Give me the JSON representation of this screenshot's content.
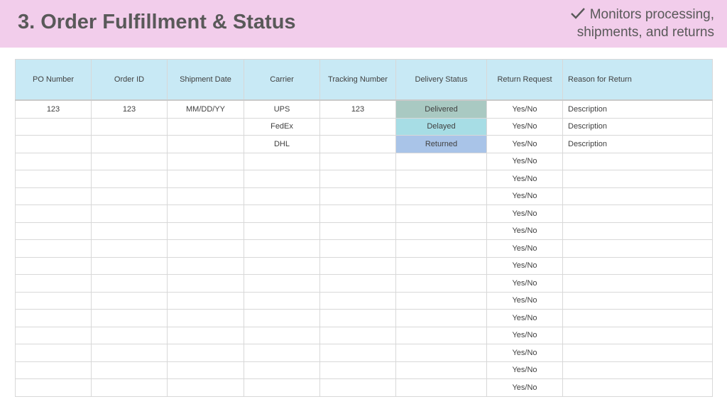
{
  "header": {
    "title": "3. Order Fulfillment & Status",
    "subtitle_line1": "Monitors processing,",
    "subtitle_line2": "shipments, and returns",
    "icon": "check-icon",
    "background": "#f2cdeb"
  },
  "table": {
    "columns": [
      "PO Number",
      "Order ID",
      "Shipment Date",
      "Carrier",
      "Tracking Number",
      "Delivery Status",
      "Return Request",
      "Reason for Return"
    ],
    "rows": [
      [
        "123",
        "123",
        "MM/DD/YY",
        "UPS",
        "123",
        "Delivered",
        "Yes/No",
        "Description"
      ],
      [
        "",
        "",
        "",
        "FedEx",
        "",
        "Delayed",
        "Yes/No",
        "Description"
      ],
      [
        "",
        "",
        "",
        "DHL",
        "",
        "Returned",
        "Yes/No",
        "Description"
      ],
      [
        "",
        "",
        "",
        "",
        "",
        "",
        "Yes/No",
        ""
      ],
      [
        "",
        "",
        "",
        "",
        "",
        "",
        "Yes/No",
        ""
      ],
      [
        "",
        "",
        "",
        "",
        "",
        "",
        "Yes/No",
        ""
      ],
      [
        "",
        "",
        "",
        "",
        "",
        "",
        "Yes/No",
        ""
      ],
      [
        "",
        "",
        "",
        "",
        "",
        "",
        "Yes/No",
        ""
      ],
      [
        "",
        "",
        "",
        "",
        "",
        "",
        "Yes/No",
        ""
      ],
      [
        "",
        "",
        "",
        "",
        "",
        "",
        "Yes/No",
        ""
      ],
      [
        "",
        "",
        "",
        "",
        "",
        "",
        "Yes/No",
        ""
      ],
      [
        "",
        "",
        "",
        "",
        "",
        "",
        "Yes/No",
        ""
      ],
      [
        "",
        "",
        "",
        "",
        "",
        "",
        "Yes/No",
        ""
      ],
      [
        "",
        "",
        "",
        "",
        "",
        "",
        "Yes/No",
        ""
      ],
      [
        "",
        "",
        "",
        "",
        "",
        "",
        "Yes/No",
        ""
      ],
      [
        "",
        "",
        "",
        "",
        "",
        "",
        "Yes/No",
        ""
      ],
      [
        "",
        "",
        "",
        "",
        "",
        "",
        "Yes/No",
        ""
      ]
    ],
    "colors": {
      "header_background": "#c8e9f5",
      "delivered": "#a9c9c2",
      "delayed": "#a7dde5",
      "returned": "#a9c4e8"
    }
  }
}
